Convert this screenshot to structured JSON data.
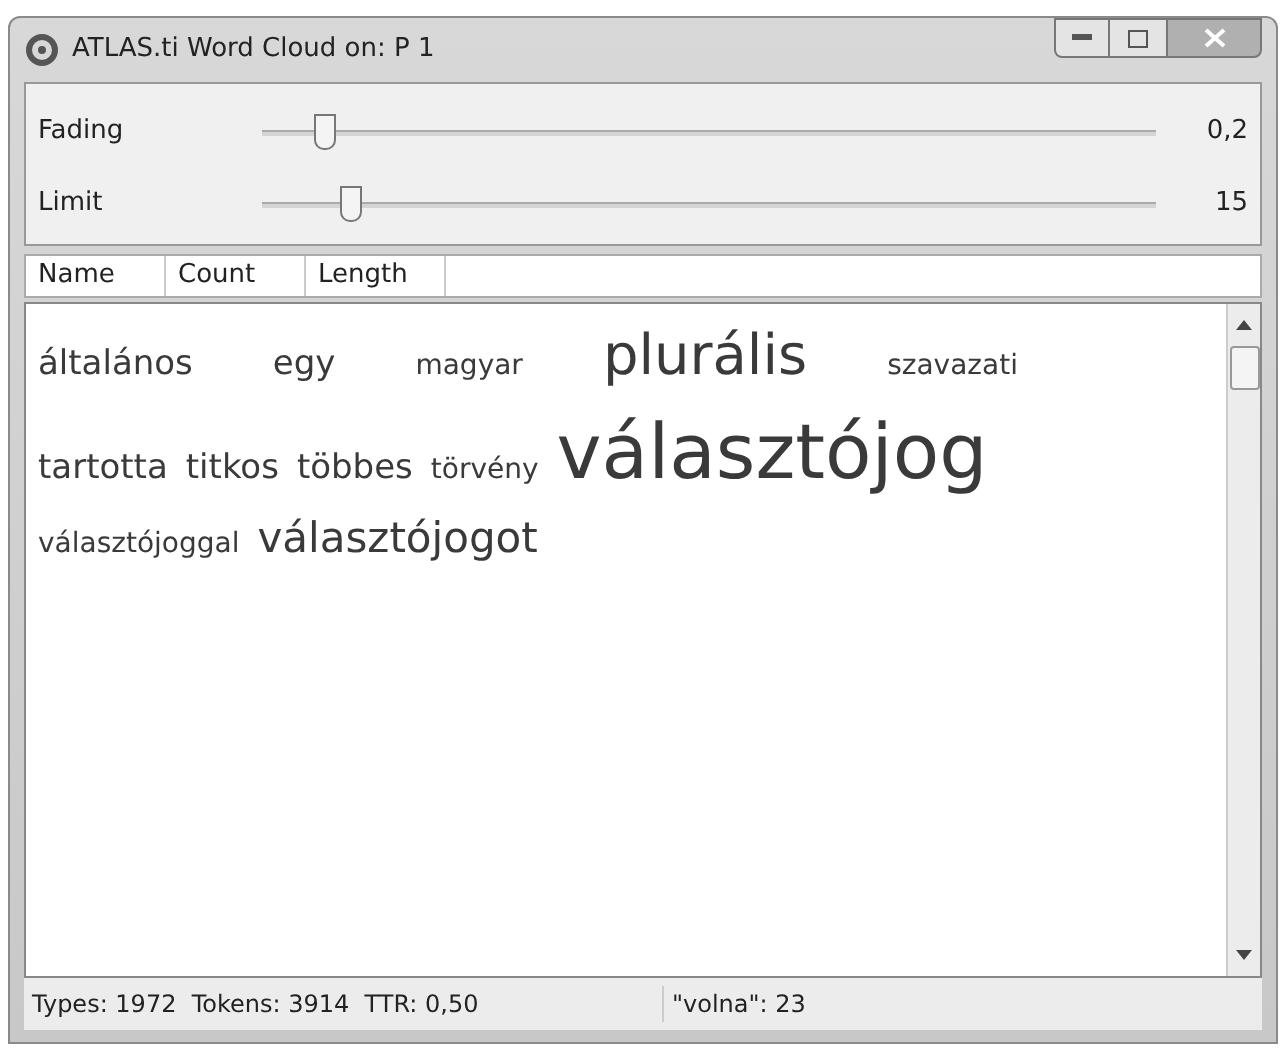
{
  "window": {
    "title": "ATLAS.ti Word Cloud on: P 1"
  },
  "sliders": [
    {
      "label": "Fading",
      "level": 0.08,
      "reading": "0,2"
    },
    {
      "label": "Limit",
      "level": 0.11,
      "reading": "15"
    }
  ],
  "columns": [
    {
      "label": "Name"
    },
    {
      "label": "Count"
    },
    {
      "label": "Length"
    }
  ],
  "cloud_rows": [
    [
      {
        "text": "általános",
        "kind": "medium"
      },
      {
        "text": "egy",
        "kind": "medium"
      },
      {
        "text": "magyar",
        "kind": "small"
      },
      {
        "text": "plurális",
        "kind": "large"
      },
      {
        "text": "szavazati",
        "kind": "small"
      }
    ],
    [
      {
        "text": "tartotta",
        "kind": "medium"
      },
      {
        "text": "titkos",
        "kind": "medium"
      },
      {
        "text": "többes",
        "kind": "medium"
      },
      {
        "text": "törvény",
        "kind": "small"
      },
      {
        "text": "választójog",
        "kind": "huge"
      }
    ],
    [
      {
        "text": "választójoggal",
        "kind": "small"
      },
      {
        "text": "választójogot",
        "kind": "big"
      }
    ]
  ],
  "status_bar": [
    "Types: 1972  Tokens: 3914  TTR: 0,50",
    "\"volna\": 23"
  ]
}
